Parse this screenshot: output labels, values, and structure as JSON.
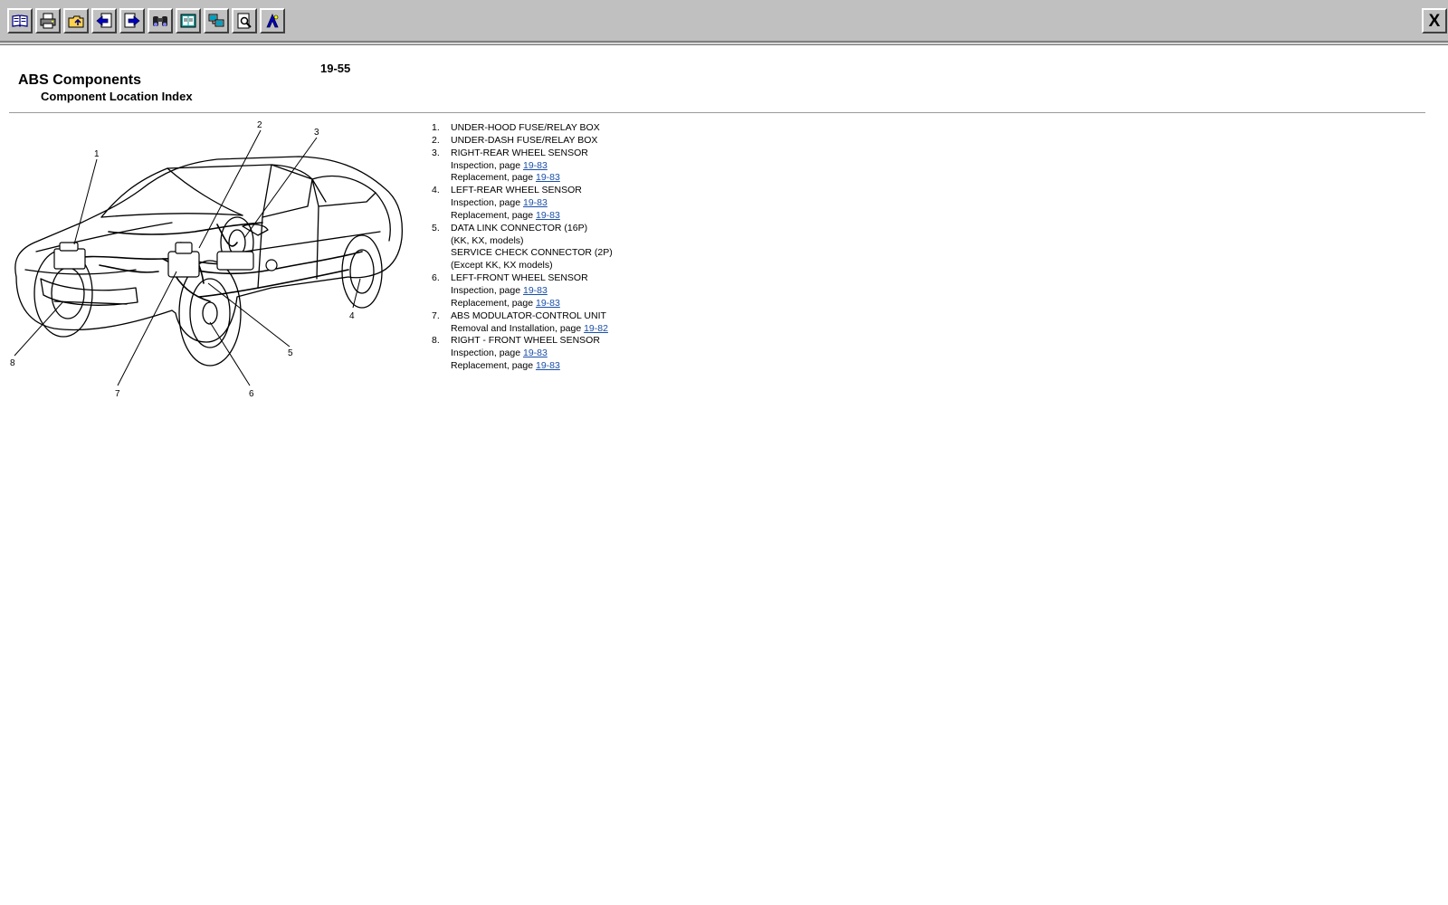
{
  "toolbar": {
    "buttons": [
      {
        "name": "contents-icon"
      },
      {
        "name": "print-icon"
      },
      {
        "name": "open-folder-icon"
      },
      {
        "name": "previous-page-icon"
      },
      {
        "name": "next-page-icon"
      },
      {
        "name": "find-icon"
      },
      {
        "name": "book-icon"
      },
      {
        "name": "network-icon"
      },
      {
        "name": "search-page-icon"
      },
      {
        "name": "bookmark-icon"
      }
    ],
    "close_label": "X"
  },
  "document": {
    "page_number": "19-55",
    "title": "ABS Components",
    "subtitle": "Component Location Index"
  },
  "diagram": {
    "callouts": [
      "1",
      "2",
      "3",
      "4",
      "5",
      "6",
      "7",
      "8"
    ]
  },
  "components": [
    {
      "num": "1.",
      "label": "UNDER-HOOD FUSE/RELAY BOX",
      "subs": []
    },
    {
      "num": "2.",
      "label": "UNDER-DASH FUSE/RELAY BOX",
      "subs": []
    },
    {
      "num": "3.",
      "label": "RIGHT-REAR WHEEL SENSOR",
      "subs": [
        {
          "text": "Inspection, page ",
          "link": "19-83"
        },
        {
          "text": "Replacement, page ",
          "link": "19-83"
        }
      ]
    },
    {
      "num": "4.",
      "label": "LEFT-REAR WHEEL SENSOR",
      "subs": [
        {
          "text": "Inspection, page ",
          "link": "19-83"
        },
        {
          "text": "Replacement, page ",
          "link": "19-83"
        }
      ]
    },
    {
      "num": "5.",
      "label": "DATA LINK CONNECTOR (16P)",
      "subs": [
        {
          "text": "(KK, KX, models)",
          "link": ""
        },
        {
          "text": "SERVICE CHECK CONNECTOR (2P)",
          "link": ""
        },
        {
          "text": "(Except KK, KX models)",
          "link": ""
        }
      ]
    },
    {
      "num": "6.",
      "label": "LEFT-FRONT WHEEL SENSOR",
      "subs": [
        {
          "text": "Inspection, page ",
          "link": "19-83"
        },
        {
          "text": "Replacement, page ",
          "link": "19-83"
        }
      ]
    },
    {
      "num": "7.",
      "label": "ABS MODULATOR-CONTROL UNIT",
      "subs": [
        {
          "text": "Removal and Installation, page ",
          "link": "19-82"
        }
      ]
    },
    {
      "num": "8.",
      "label": "RIGHT - FRONT WHEEL SENSOR",
      "subs": [
        {
          "text": "Inspection, page ",
          "link": "19-83"
        },
        {
          "text": "Replacement, page ",
          "link": "19-83"
        }
      ]
    }
  ]
}
